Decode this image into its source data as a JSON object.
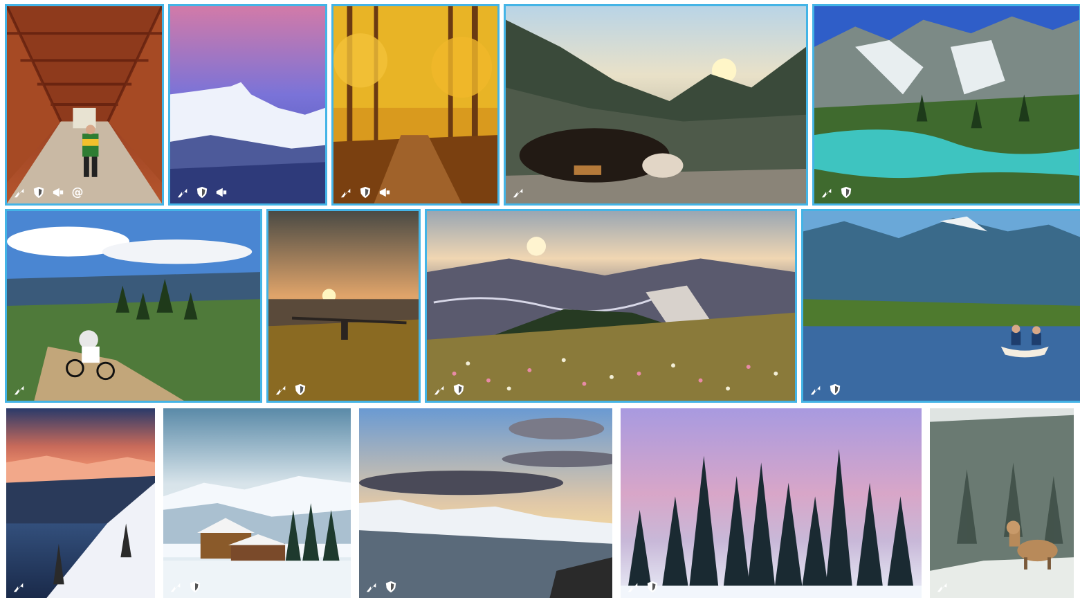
{
  "gallery": {
    "accent_color": "#44b4e6",
    "icon_color": "#ffffff",
    "rows": [
      {
        "tiles": [
          {
            "scene": "covered-bridge-walker",
            "icons": [
              "share-icon",
              "shield-icon",
              "megaphone-icon",
              "at-icon"
            ],
            "at_label": "@"
          },
          {
            "scene": "pink-sky-snowy-peak",
            "icons": [
              "share-icon",
              "shield-icon",
              "megaphone-icon"
            ]
          },
          {
            "scene": "autumn-forest-path",
            "icons": [
              "share-icon",
              "shield-icon",
              "megaphone-icon"
            ]
          },
          {
            "scene": "dog-mountain-sunset",
            "icons": [
              "share-icon"
            ]
          },
          {
            "scene": "alpine-turquoise-lake",
            "icons": [
              "share-icon",
              "shield-icon"
            ]
          }
        ]
      },
      {
        "tiles": [
          {
            "scene": "mountain-biker-trail",
            "icons": [
              "share-icon"
            ]
          },
          {
            "scene": "paraglider-sunset",
            "icons": [
              "share-icon",
              "shield-icon"
            ]
          },
          {
            "scene": "wildflower-valley-sunset",
            "icons": [
              "share-icon",
              "shield-icon"
            ]
          },
          {
            "scene": "canoe-on-lake",
            "icons": [
              "share-icon",
              "shield-icon"
            ]
          }
        ]
      },
      {
        "tiles": [
          {
            "scene": "snowy-ridge-dusk",
            "icons": [
              "share-icon"
            ]
          },
          {
            "scene": "snowy-cabin",
            "icons": [
              "share-icon",
              "shield-icon"
            ]
          },
          {
            "scene": "cloudy-snowy-range",
            "icons": [
              "share-icon",
              "shield-icon"
            ]
          },
          {
            "scene": "snowy-pines-pink-sky",
            "icons": [
              "share-icon",
              "shield-icon"
            ]
          },
          {
            "scene": "bighorn-sheep-snow",
            "icons": [
              "share-icon"
            ]
          }
        ]
      }
    ]
  }
}
